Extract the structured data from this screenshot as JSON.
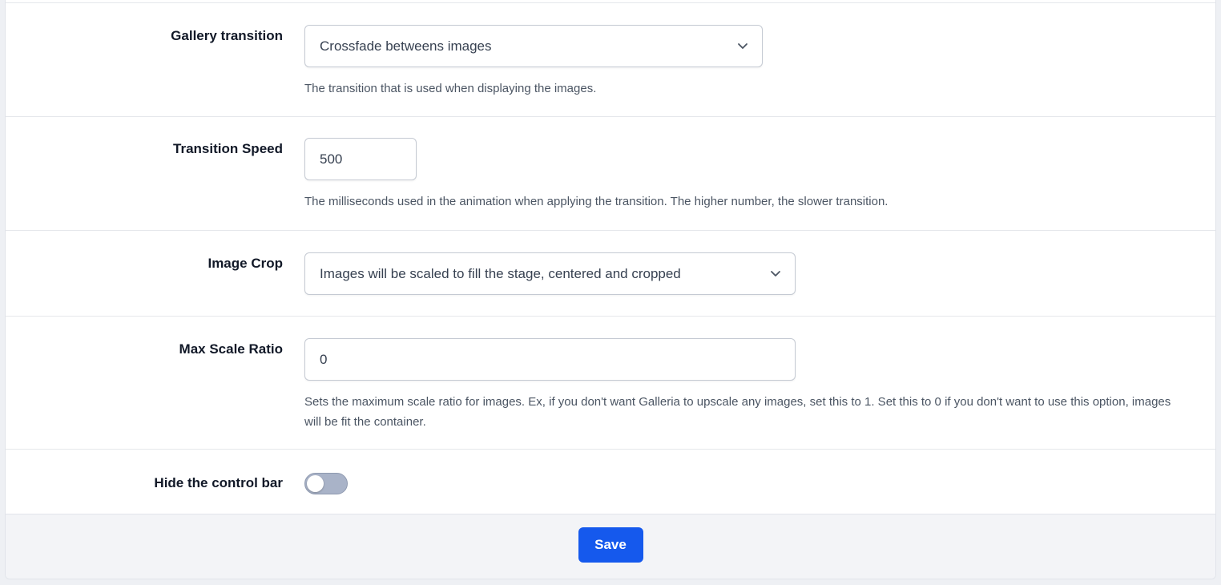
{
  "fields": {
    "gallery_transition": {
      "label": "Gallery transition",
      "selected": "Crossfade betweens images",
      "help": "The transition that is used when displaying the images."
    },
    "transition_speed": {
      "label": "Transition Speed",
      "value": "500",
      "help": "The milliseconds used in the animation when applying the transition. The higher number, the slower transition."
    },
    "image_crop": {
      "label": "Image Crop",
      "selected": "Images will be scaled to fill the stage, centered and cropped"
    },
    "max_scale_ratio": {
      "label": "Max Scale Ratio",
      "value": "0",
      "help": "Sets the maximum scale ratio for images. Ex, if you don't want Galleria to upscale any images, set this to 1. Set this to 0 if you don't want to use this option, images will be fit the container."
    },
    "hide_control_bar": {
      "label": "Hide the control bar",
      "enabled": false
    }
  },
  "footer": {
    "save_label": "Save"
  },
  "icons": {
    "select_arrow": "chevron-down-icon"
  },
  "colors": {
    "primary": "#1559ed",
    "toggle_off": "#a9b3c8"
  }
}
